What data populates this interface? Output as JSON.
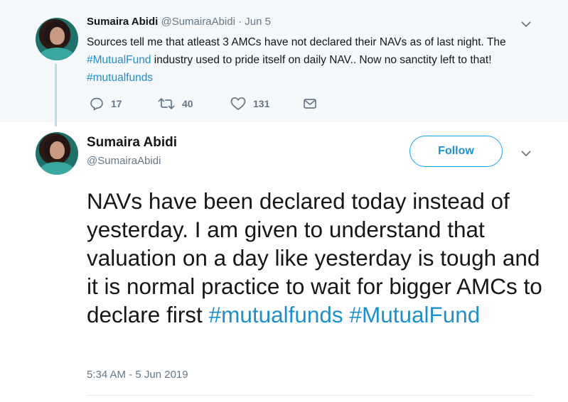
{
  "parent_tweet": {
    "author_name": "Sumaira Abidi",
    "author_handle": "@SumairaAbidi",
    "separator": "·",
    "date": "Jun 5",
    "text_segments": [
      {
        "text": "Sources tell me that atleast 3 AMCs have not declared their NAVs as of last night. The ",
        "type": "text"
      },
      {
        "text": "#MutualFund",
        "type": "hashtag"
      },
      {
        "text": " industry used to pride itself on daily NAV.. Now no sanctity left to that! ",
        "type": "text"
      },
      {
        "text": "#mutualfunds",
        "type": "hashtag"
      }
    ],
    "reply_count": "17",
    "retweet_count": "40",
    "like_count": "131",
    "icons": [
      "reply-icon",
      "retweet-icon",
      "like-icon",
      "message-icon",
      "chevron-down-icon"
    ]
  },
  "main_tweet": {
    "author_name": "Sumaira Abidi",
    "author_handle": "@SumairaAbidi",
    "follow_label": "Follow",
    "text_segments": [
      {
        "text": "NAVs have been declared today instead of yesterday. I am given to understand that valuation on a day like yesterday is tough and it is normal practice to wait for bigger AMCs to declare first ",
        "type": "text"
      },
      {
        "text": "#mutualfunds",
        "type": "hashtag"
      },
      {
        "text": " ",
        "type": "text"
      },
      {
        "text": "#MutualFund",
        "type": "hashtag"
      }
    ],
    "timestamp": "5:34 AM - 5 Jun 2019"
  },
  "colors": {
    "hashtag": "#1f8fc9",
    "follow": "#1da1f2",
    "muted": "#657786",
    "thread_line": "#b7e0ea",
    "parent_bg": "#f5f8fa"
  }
}
